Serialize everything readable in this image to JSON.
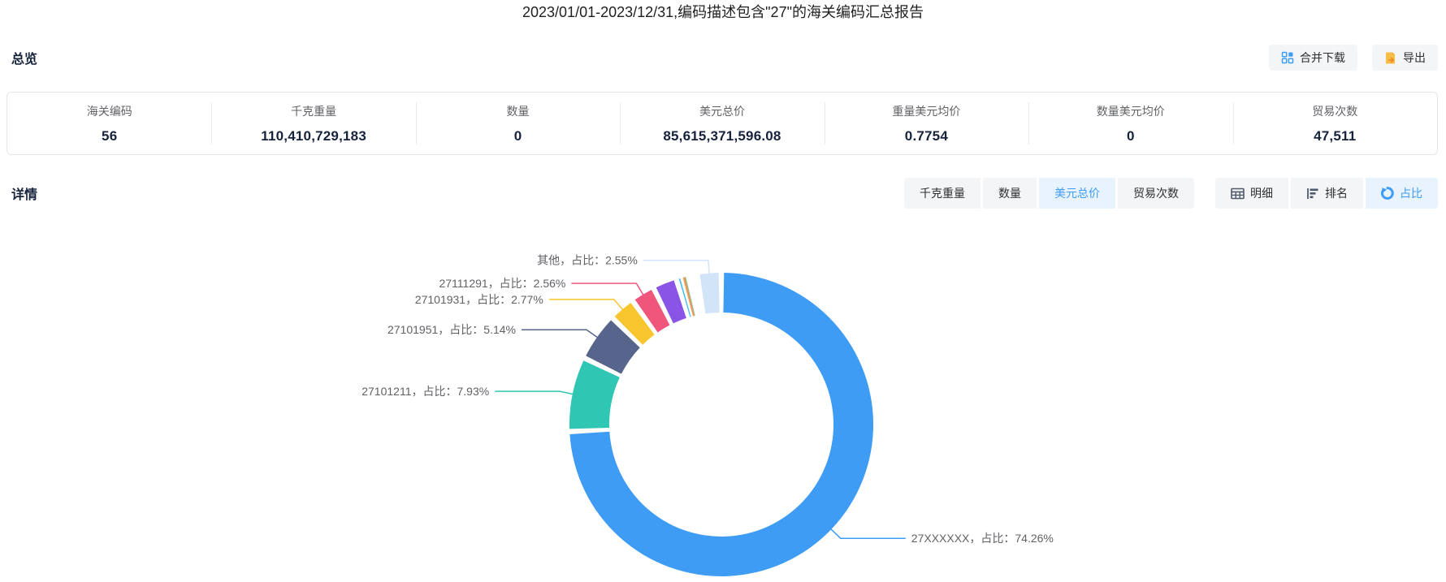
{
  "title": "2023/01/01-2023/12/31,编码描述包含\"27\"的海关编码汇总报告",
  "overview": {
    "heading": "总览",
    "buttons": {
      "merge_download": "合并下载",
      "export": "导出"
    },
    "stats": [
      {
        "label": "海关编码",
        "value": "56"
      },
      {
        "label": "千克重量",
        "value": "110,410,729,183"
      },
      {
        "label": "数量",
        "value": "0"
      },
      {
        "label": "美元总价",
        "value": "85,615,371,596.08"
      },
      {
        "label": "重量美元均价",
        "value": "0.7754"
      },
      {
        "label": "数量美元均价",
        "value": "0"
      },
      {
        "label": "贸易次数",
        "value": "47,511"
      }
    ]
  },
  "detail": {
    "heading": "详情",
    "metric_tabs": [
      {
        "label": "千克重量",
        "active": false
      },
      {
        "label": "数量",
        "active": false
      },
      {
        "label": "美元总价",
        "active": true
      },
      {
        "label": "贸易次数",
        "active": false
      }
    ],
    "view_tabs": [
      {
        "label": "明细",
        "icon": "table-icon",
        "active": false
      },
      {
        "label": "排名",
        "icon": "ranking-icon",
        "active": false
      },
      {
        "label": "占比",
        "icon": "pie-icon",
        "active": true
      }
    ]
  },
  "colors": {
    "accent": "#3e9cf4",
    "active_tab_bg": "#e8f3fd",
    "button_bg": "#f4f5f7",
    "export_icon_orange": "#fbbd4a",
    "label_gray": "#606266"
  },
  "chart_data": {
    "type": "pie",
    "subtype": "donut",
    "metric": "美元总价",
    "legend_position": "none",
    "segments": [
      {
        "name": "27XXXXXX",
        "percent": 74.26,
        "color": "#3e9cf4",
        "labeled": true,
        "label": "27XXXXXX，占比：74.26%"
      },
      {
        "name": "27101211",
        "percent": 7.93,
        "color": "#2fc6b4",
        "labeled": true,
        "label": "27101211，占比：7.93%"
      },
      {
        "name": "27101951",
        "percent": 5.14,
        "color": "#57648b",
        "labeled": true,
        "label": "27101951，占比：5.14%"
      },
      {
        "name": "27101931",
        "percent": 2.77,
        "color": "#f7c62f",
        "labeled": true,
        "label": "27101931，占比：2.77%"
      },
      {
        "name": "27111291",
        "percent": 2.56,
        "color": "#f0557c",
        "labeled": true,
        "label": "27111291，占比：2.56%"
      },
      {
        "name": "",
        "percent": 2.55,
        "color": "#8a55e6",
        "labeled": false,
        "label": ""
      },
      {
        "name": "",
        "percent": 0.7,
        "color": "#41bef0",
        "labeled": false,
        "label": ""
      },
      {
        "name": "",
        "percent": 0.12,
        "color": "#f59a23",
        "labeled": false,
        "label": ""
      },
      {
        "name": "",
        "percent": 0.1,
        "color": "#f56c6c",
        "labeled": false,
        "label": ""
      },
      {
        "name": "",
        "percent": 0.08,
        "color": "#67c23a",
        "labeled": false,
        "label": ""
      },
      {
        "name": "",
        "percent": 0.06,
        "color": "#c0c6d2",
        "labeled": false,
        "label": ""
      },
      {
        "name": "",
        "percent": 1.18,
        "color": "#ffffff",
        "labeled": false,
        "label": ""
      },
      {
        "name": "其他",
        "percent": 2.55,
        "color": "#d2e4f8",
        "labeled": true,
        "label": "其他，占比：2.55%"
      }
    ]
  }
}
